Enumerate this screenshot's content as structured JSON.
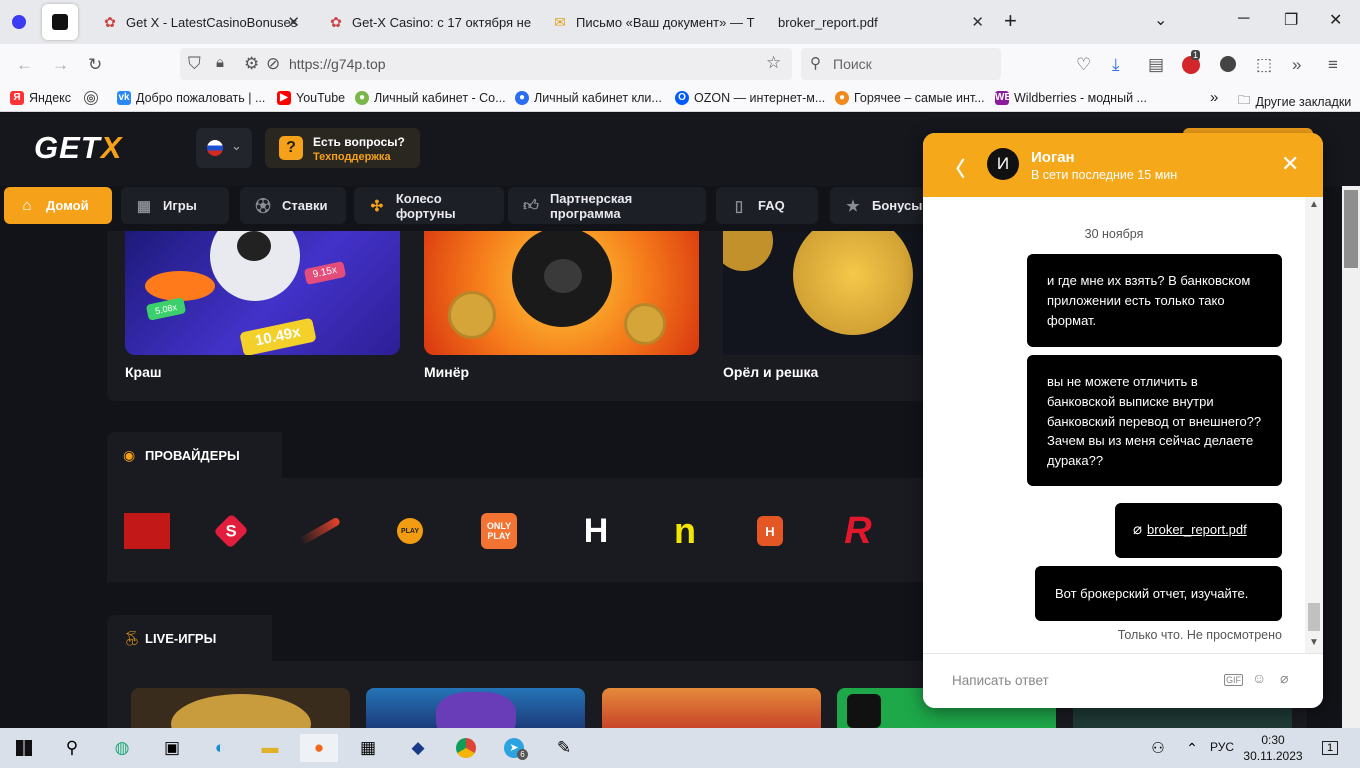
{
  "browser": {
    "tabs": [
      {
        "label": "Get X - LatestCasinoBonuses",
        "icon": "bonus-icon"
      },
      {
        "label": "Get-X Casino: с 17 октября не г",
        "icon": "bonus-icon"
      },
      {
        "label": "Письмо «Ваш документ» — Т",
        "icon": "mail-icon"
      },
      {
        "label": "broker_report.pdf",
        "icon": "pdf-icon"
      }
    ],
    "url": "https://g74p.top",
    "search_placeholder": "Поиск",
    "extension_badge": "1",
    "bookmarks": [
      "Яндекс",
      "Добро пожаловать | ...",
      "YouTube",
      "Личный кабинет - Со...",
      "Личный кабинет кли...",
      "OZON — интернет-м...",
      "Горячее – самые инт...",
      "Wildberries - модный ..."
    ],
    "bookmarks_other": "Другие закладки"
  },
  "site": {
    "logo_main": "GET",
    "logo_accent": "X",
    "support_title": "Есть вопросы?",
    "support_subtitle": "Техподдержка",
    "menu": [
      {
        "label": "Домой",
        "icon": "home-icon"
      },
      {
        "label": "Игры",
        "icon": "games-icon"
      },
      {
        "label": "Ставки",
        "icon": "ball-icon"
      },
      {
        "label": "Колесо фортуны",
        "icon": "wheel-icon"
      },
      {
        "label": "Партнерская программа",
        "icon": "thumbs-up-icon"
      },
      {
        "label": "FAQ",
        "icon": "book-icon"
      },
      {
        "label": "Бонусы",
        "icon": "star-icon"
      }
    ],
    "games": [
      {
        "title": "Краш",
        "badge1": "10.49x",
        "badge2": "9.15x",
        "badge3": "5.08x"
      },
      {
        "title": "Минёр"
      },
      {
        "title": "Орёл и решка"
      }
    ],
    "providers_title": "ПРОВАЙДЕРЫ",
    "providers": [
      {
        "name": "Evoplay",
        "label": ""
      },
      {
        "name": "Smartsoft",
        "label": "S"
      },
      {
        "name": "Spribe",
        "label": ""
      },
      {
        "name": "Pragmatic Play",
        "label": "PLAY"
      },
      {
        "name": "Onlyplay",
        "label": "ONLY PLAY"
      },
      {
        "name": "Hacksaw",
        "label": "H"
      },
      {
        "name": "Netgame",
        "label": "n"
      },
      {
        "name": "Habanero",
        "label": "H"
      },
      {
        "name": "Red Tiger",
        "label": "R"
      }
    ],
    "live_title": "LIVE-ИГРЫ"
  },
  "chat": {
    "agent_initial": "И",
    "agent_name": "Иоган",
    "agent_status": "В сети последние 15 мин",
    "date": "30 ноября",
    "messages": [
      {
        "text": "и где мне их взять? В банковском приложении есть только тако формат."
      },
      {
        "text": "вы не можете отличить в банковской выписке внутри банковский перевод от внешнего?? Зачем вы из меня сейчас делаете дурака??"
      },
      {
        "text": "broker_report.pdf",
        "type": "file"
      },
      {
        "text": "Вот брокерский отчет, изучайте."
      }
    ],
    "last_meta": "Только что. Не просмотрено",
    "input_placeholder": "Написать ответ"
  },
  "taskbar": {
    "lang": "РУС",
    "time": "0:30",
    "date": "30.11.2023",
    "notifications": "1",
    "telegram_badge": "6"
  },
  "colors": {
    "accent": "#f5a11a",
    "chat_header": "#f6a81b",
    "site_bg": "#121318"
  }
}
